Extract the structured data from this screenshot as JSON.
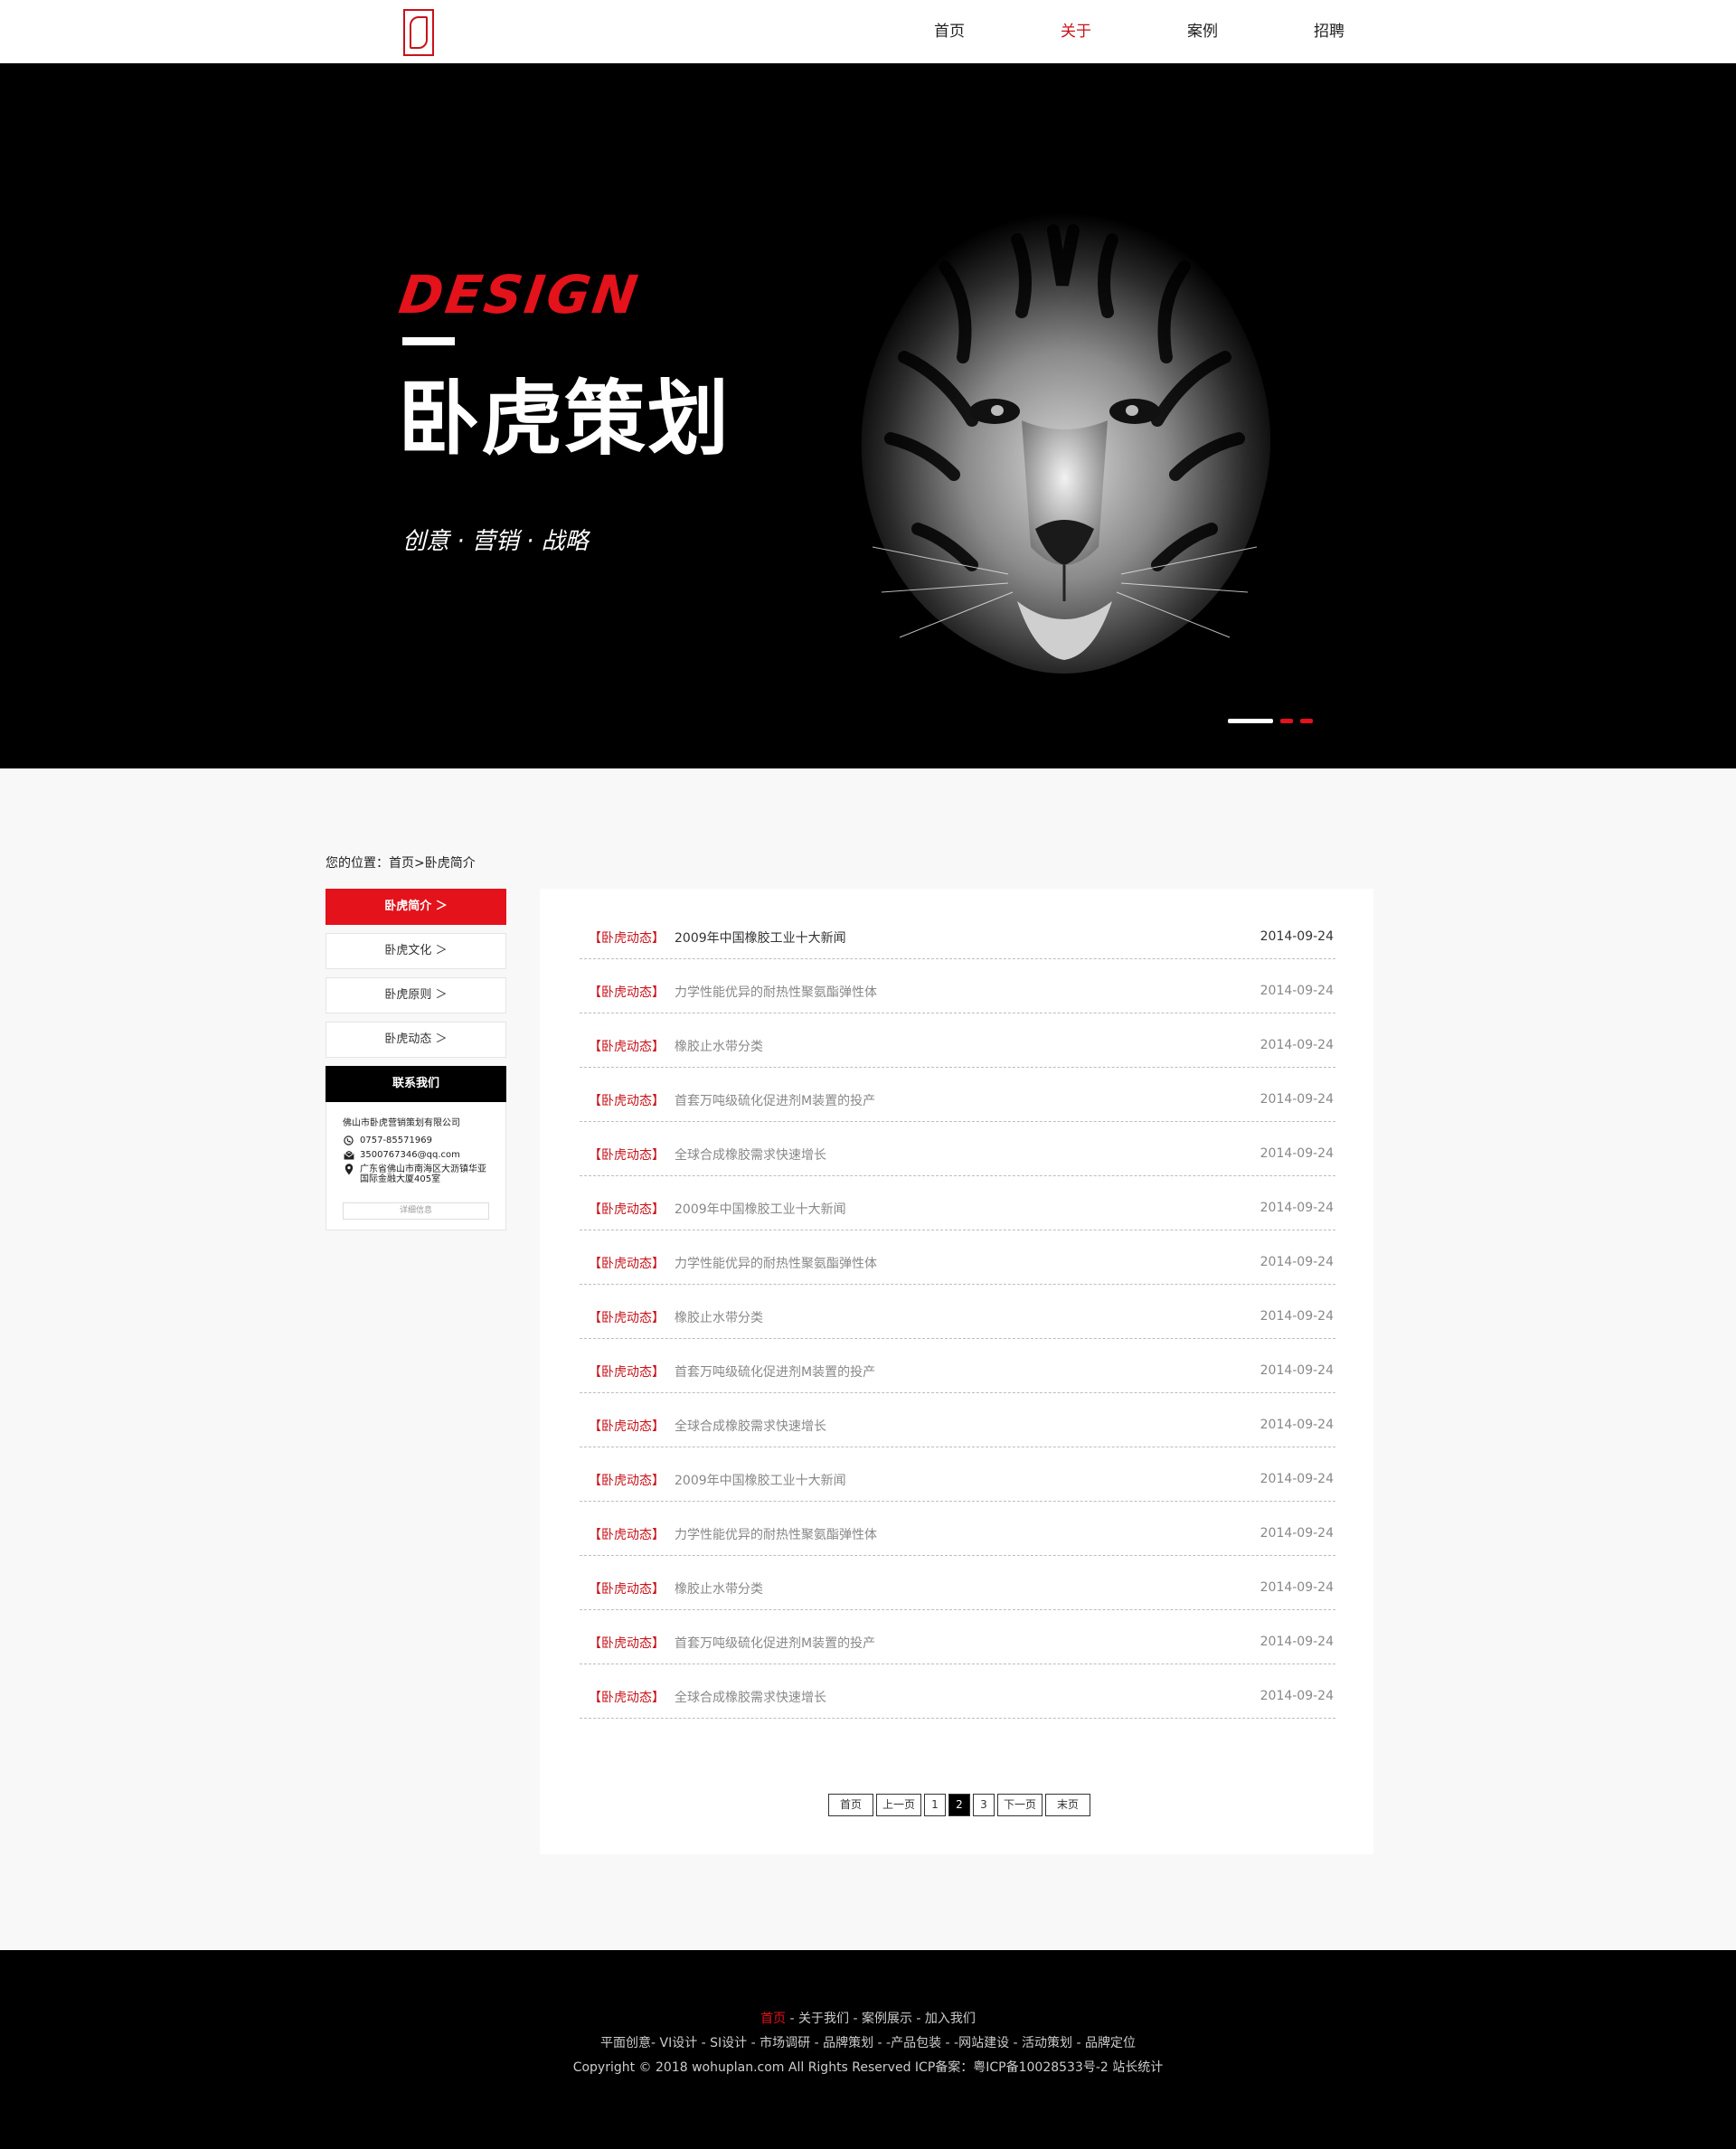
{
  "nav": {
    "items": [
      {
        "label": "首页"
      },
      {
        "label": "关于"
      },
      {
        "label": "案例"
      },
      {
        "label": "招聘"
      }
    ]
  },
  "banner": {
    "design_word": "DESIGN",
    "title": "卧虎策划",
    "tagline": "创意 · 营销 · 战略"
  },
  "breadcrumb": {
    "text": "您的位置：首页>卧虎简介"
  },
  "sidebar": {
    "items": [
      {
        "label": "卧虎简介 ＞"
      },
      {
        "label": "卧虎文化 ＞"
      },
      {
        "label": "卧虎原则 ＞"
      },
      {
        "label": "卧虎动态 ＞"
      }
    ],
    "contact_title": "联系我们",
    "contact": {
      "company": "佛山市卧虎营销策划有限公司",
      "phone": "0757-85571969",
      "email": "3500767346@qq.com",
      "address": "广东省佛山市南海区大沥镇华亚国际金融大厦405室",
      "detail_button": "详细信息"
    }
  },
  "news": {
    "tag": "【卧虎动态】",
    "rows": [
      {
        "title": "2009年中国橡胶工业十大新闻",
        "date": "2014-09-24"
      },
      {
        "title": "力学性能优异的耐热性聚氨酯弹性体",
        "date": "2014-09-24"
      },
      {
        "title": "橡胶止水带分类",
        "date": "2014-09-24"
      },
      {
        "title": "首套万吨级硫化促进剂M装置的投产",
        "date": "2014-09-24"
      },
      {
        "title": "全球合成橡胶需求快速增长",
        "date": "2014-09-24"
      },
      {
        "title": "2009年中国橡胶工业十大新闻",
        "date": "2014-09-24"
      },
      {
        "title": "力学性能优异的耐热性聚氨酯弹性体",
        "date": "2014-09-24"
      },
      {
        "title": "橡胶止水带分类",
        "date": "2014-09-24"
      },
      {
        "title": "首套万吨级硫化促进剂M装置的投产",
        "date": "2014-09-24"
      },
      {
        "title": "全球合成橡胶需求快速增长",
        "date": "2014-09-24"
      },
      {
        "title": "2009年中国橡胶工业十大新闻",
        "date": "2014-09-24"
      },
      {
        "title": "力学性能优异的耐热性聚氨酯弹性体",
        "date": "2014-09-24"
      },
      {
        "title": "橡胶止水带分类",
        "date": "2014-09-24"
      },
      {
        "title": "首套万吨级硫化促进剂M装置的投产",
        "date": "2014-09-24"
      },
      {
        "title": "全球合成橡胶需求快速增长",
        "date": "2014-09-24"
      }
    ]
  },
  "pager": {
    "first": "首页",
    "prev": "上一页",
    "pages": [
      "1",
      "2",
      "3"
    ],
    "current": "2",
    "next": "下一页",
    "last": "末页"
  },
  "footer": {
    "links": [
      "首页",
      "关于我们",
      "案例展示",
      "加入我们"
    ],
    "services": "平面创意- VI设计 - SI设计 - 市场调研 - 品牌策划 - -产品包装 - -网站建设 - 活动策划 - 品牌定位",
    "copyright": "Copyright © 2018 wohuplan.com All Rights Reserved ICP备案：粤ICP备10028533号-2 站长统计"
  },
  "colors": {
    "accent": "#e3121b",
    "dark": "#000000"
  }
}
